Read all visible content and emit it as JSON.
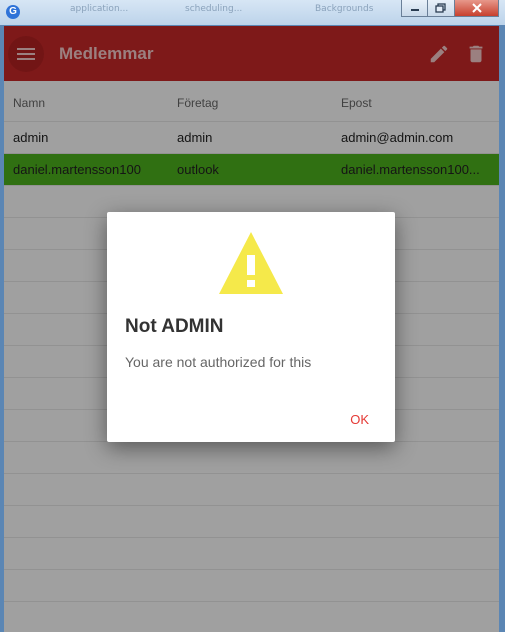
{
  "window": {
    "app_icon_letter": "G",
    "tabs": [
      "application...",
      "scheduling...",
      "Backgrounds"
    ],
    "controls": [
      "minimize",
      "maximize",
      "close"
    ]
  },
  "appbar": {
    "title": "Medlemmar",
    "menu_icon": "menu-icon",
    "edit_icon": "pencil-icon",
    "delete_icon": "trash-icon"
  },
  "table": {
    "columns": [
      "Namn",
      "Företag",
      "Epost"
    ],
    "rows": [
      {
        "name": "admin",
        "company": "admin",
        "email": "admin@admin.com",
        "selected": false
      },
      {
        "name": "daniel.martensson100",
        "company": "outlook",
        "email": "daniel.martensson100...",
        "selected": true
      }
    ]
  },
  "dialog": {
    "icon": "warning-icon",
    "title": "Not ADMIN",
    "message": "You are not authorized for this",
    "ok_label": "OK"
  },
  "colors": {
    "appbar": "#c62828",
    "selected_row": "#4caf1d",
    "warning": "#f5e94a",
    "ok": "#e53935"
  }
}
